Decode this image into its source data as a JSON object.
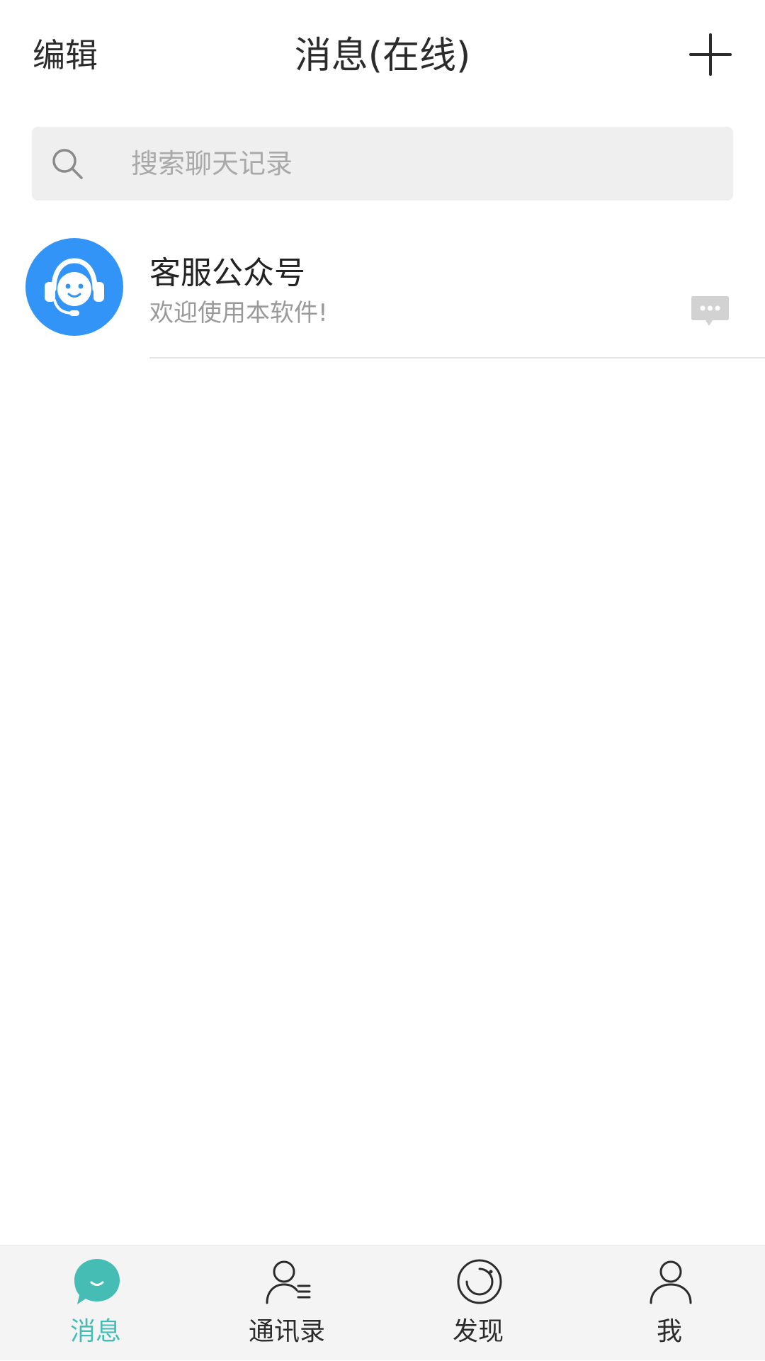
{
  "header": {
    "edit_label": "编辑",
    "title": "消息(在线)",
    "add_icon": "plus-icon"
  },
  "search": {
    "placeholder": "搜索聊天记录",
    "value": "",
    "icon": "search-icon"
  },
  "conversations": [
    {
      "name": "客服公众号",
      "preview": "欢迎使用本软件!",
      "avatar_icon": "customer-service-headset-icon",
      "avatar_color": "#3294f6",
      "status_icon": "chat-bubble-icon"
    }
  ],
  "tabbar": {
    "tabs": [
      {
        "label": "消息",
        "icon": "message-bubble-icon",
        "active": true
      },
      {
        "label": "通讯录",
        "icon": "contacts-icon",
        "active": false
      },
      {
        "label": "发现",
        "icon": "discover-icon",
        "active": false
      },
      {
        "label": "我",
        "icon": "profile-icon",
        "active": false
      }
    ]
  },
  "colors": {
    "accent": "#45bdb4",
    "avatar_blue": "#3294f6",
    "search_bg": "#efefef",
    "tabbar_bg": "#f4f4f4"
  }
}
